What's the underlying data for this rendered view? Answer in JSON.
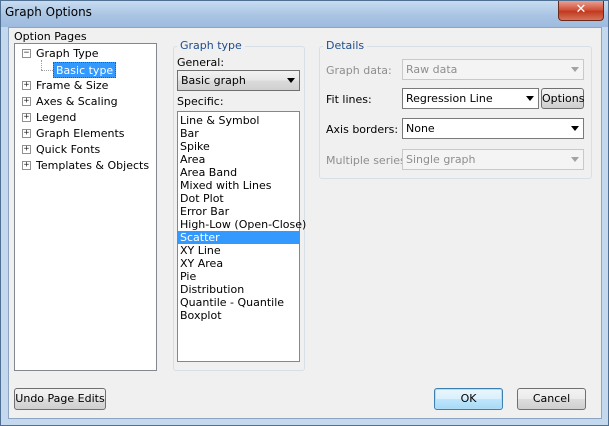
{
  "window": {
    "title": "Graph Options",
    "close_glyph": "✕"
  },
  "option_pages": {
    "title": "Option Pages",
    "tree": [
      {
        "label": "Graph Type",
        "expanded": true,
        "children": [
          {
            "label": "Basic type",
            "selected": true
          }
        ]
      },
      {
        "label": "Frame & Size"
      },
      {
        "label": "Axes & Scaling"
      },
      {
        "label": "Legend"
      },
      {
        "label": "Graph Elements"
      },
      {
        "label": "Quick Fonts"
      },
      {
        "label": "Templates & Objects"
      }
    ],
    "collapse_glyph": "−",
    "expand_glyph": "+"
  },
  "graph_type": {
    "title": "Graph type",
    "general_label": "General:",
    "general_value": "Basic graph",
    "specific_label": "Specific:",
    "specific_items": [
      "Line & Symbol",
      "Bar",
      "Spike",
      "Area",
      "Area Band",
      "Mixed with Lines",
      "Dot Plot",
      "Error Bar",
      "High-Low (Open-Close)",
      "Scatter",
      "XY Line",
      "XY Area",
      "Pie",
      "Distribution",
      "Quantile - Quantile",
      "Boxplot"
    ],
    "selected_specific": "Scatter"
  },
  "details": {
    "title": "Details",
    "graph_data_label": "Graph data:",
    "graph_data_value": "Raw data",
    "fit_lines_label": "Fit lines:",
    "fit_lines_value": "Regression Line",
    "options_button": "Options",
    "axis_borders_label": "Axis borders:",
    "axis_borders_value": "None",
    "multiple_series_label": "Multiple series:",
    "multiple_series_value": "Single graph"
  },
  "buttons": {
    "undo": "Undo Page Edits",
    "ok": "OK",
    "cancel": "Cancel"
  },
  "colors": {
    "selection": "#3399ff",
    "group_title": "#1e4d8c",
    "close_button": "#c03a1f"
  }
}
